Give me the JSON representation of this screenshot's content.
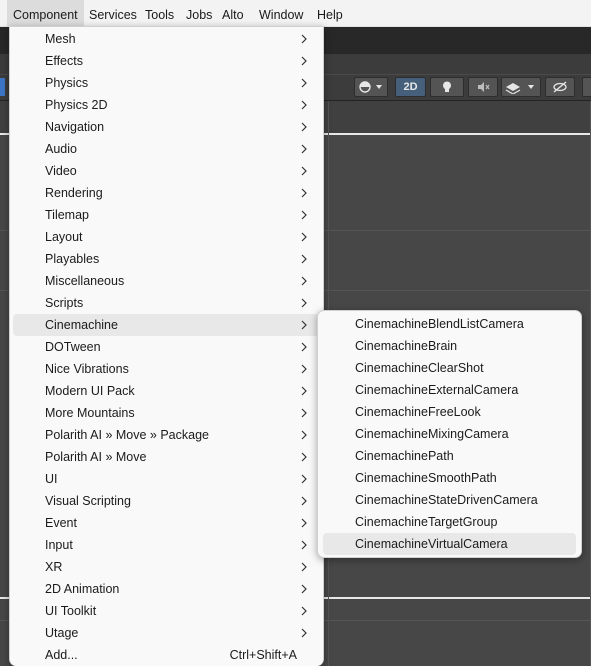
{
  "menubar": {
    "items": [
      {
        "label": "Component",
        "active": true
      },
      {
        "label": "Services"
      },
      {
        "label": "Tools"
      },
      {
        "label": "Jobs"
      },
      {
        "label": "Alto"
      },
      {
        "label": "Window"
      },
      {
        "label": "Help"
      }
    ]
  },
  "toolbar": {
    "toggle_2d_label": "2D"
  },
  "component_menu": {
    "items": [
      {
        "label": "Mesh"
      },
      {
        "label": "Effects"
      },
      {
        "label": "Physics"
      },
      {
        "label": "Physics 2D"
      },
      {
        "label": "Navigation"
      },
      {
        "label": "Audio"
      },
      {
        "label": "Video"
      },
      {
        "label": "Rendering"
      },
      {
        "label": "Tilemap"
      },
      {
        "label": "Layout"
      },
      {
        "label": "Playables"
      },
      {
        "label": "Miscellaneous"
      },
      {
        "label": "Scripts"
      },
      {
        "label": "Cinemachine",
        "highlighted": true
      },
      {
        "label": "DOTween"
      },
      {
        "label": "Nice Vibrations"
      },
      {
        "label": "Modern UI Pack"
      },
      {
        "label": "More Mountains"
      },
      {
        "label": "Polarith AI » Move » Package"
      },
      {
        "label": "Polarith AI » Move"
      },
      {
        "label": "UI"
      },
      {
        "label": "Visual Scripting"
      },
      {
        "label": "Event"
      },
      {
        "label": "Input"
      },
      {
        "label": "XR"
      },
      {
        "label": "2D Animation"
      },
      {
        "label": "UI Toolkit"
      },
      {
        "label": "Utage"
      },
      {
        "label": "Add...",
        "shortcut": "Ctrl+Shift+A"
      }
    ]
  },
  "cinemachine_submenu": {
    "items": [
      {
        "label": "CinemachineBlendListCamera"
      },
      {
        "label": "CinemachineBrain"
      },
      {
        "label": "CinemachineClearShot"
      },
      {
        "label": "CinemachineExternalCamera"
      },
      {
        "label": "CinemachineFreeLook"
      },
      {
        "label": "CinemachineMixingCamera"
      },
      {
        "label": "CinemachinePath"
      },
      {
        "label": "CinemachineSmoothPath"
      },
      {
        "label": "CinemachineStateDrivenCamera"
      },
      {
        "label": "CinemachineTargetGroup"
      },
      {
        "label": "CinemachineVirtualCamera",
        "highlighted": true
      }
    ]
  },
  "colors": {
    "menu_background": "#f9f9f9",
    "menu_highlight": "#e8e8e8",
    "editor_background": "#474747",
    "toggle_active": "#46607c"
  }
}
